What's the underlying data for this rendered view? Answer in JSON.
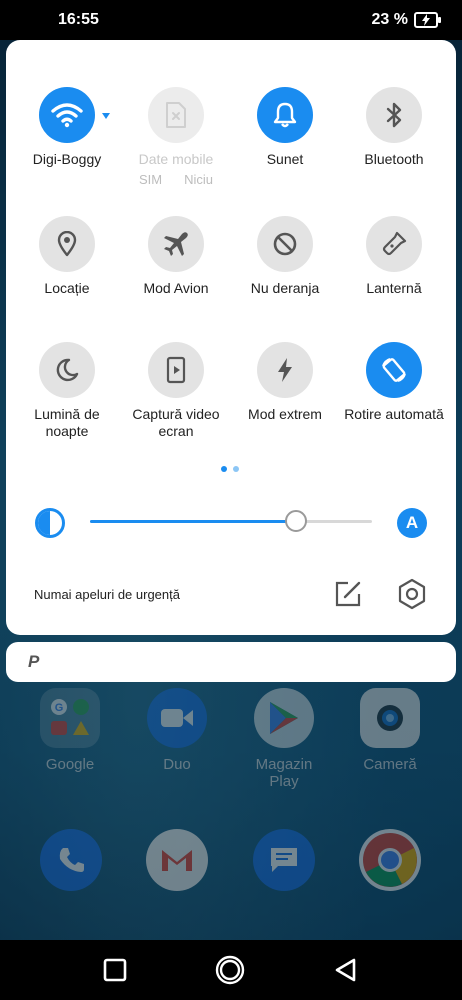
{
  "status": {
    "time": "16:55",
    "battery": "23 %"
  },
  "tiles": [
    {
      "label": "Digi-Boggy",
      "icon": "wifi-icon",
      "state": "active"
    },
    {
      "label": "Date mobile",
      "icon": "sim-card-icon",
      "state": "disabled",
      "sub_left": "SIM",
      "sub_right": "Niciu"
    },
    {
      "label": "Sunet",
      "icon": "bell-icon",
      "state": "active"
    },
    {
      "label": "Bluetooth",
      "icon": "bluetooth-icon",
      "state": "inactive"
    },
    {
      "label": "Locație",
      "icon": "location-pin-icon",
      "state": "inactive"
    },
    {
      "label": "Mod Avion",
      "icon": "airplane-icon",
      "state": "inactive"
    },
    {
      "label": "Nu deranja",
      "icon": "do-not-disturb-icon",
      "state": "inactive"
    },
    {
      "label": "Lanternă",
      "icon": "flashlight-icon",
      "state": "inactive"
    },
    {
      "label": "Lumină de noapte",
      "icon": "moon-icon",
      "state": "inactive"
    },
    {
      "label": "Captură video ecran",
      "icon": "screen-record-icon",
      "state": "inactive"
    },
    {
      "label": "Mod extrem",
      "icon": "lightning-icon",
      "state": "inactive"
    },
    {
      "label": "Rotire automată",
      "icon": "auto-rotate-icon",
      "state": "active"
    }
  ],
  "pager": {
    "pages": 2,
    "current": 1
  },
  "brightness": {
    "level": 0.73,
    "auto_label": "A"
  },
  "footer": {
    "emergency_text": "Numai apeluri de urgență"
  },
  "search": {
    "logo": "P"
  },
  "apps": [
    {
      "name": "Google"
    },
    {
      "name": "Duo"
    },
    {
      "name": "Magazin Play"
    },
    {
      "name": "Cameră"
    }
  ],
  "colors": {
    "accent": "#1a8cf0",
    "inactive_tile": "#e3e3e3"
  }
}
